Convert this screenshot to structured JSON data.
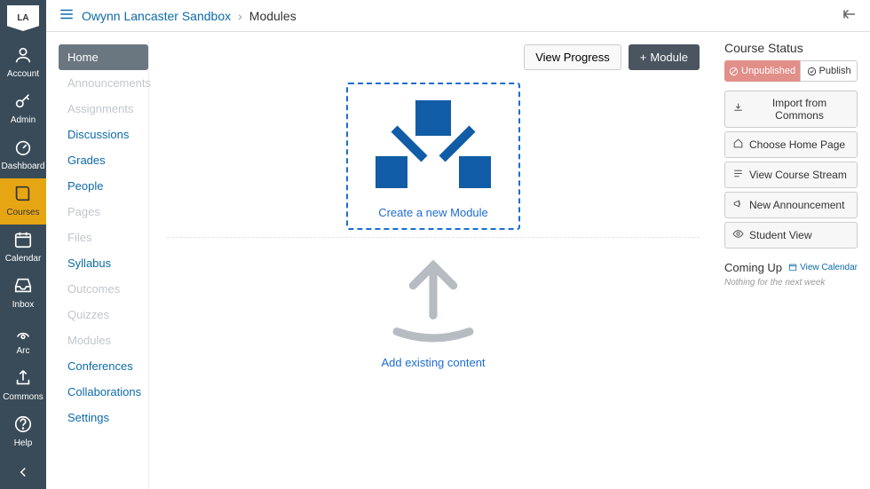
{
  "logo_text": "LA",
  "global_nav": [
    {
      "label": "Account",
      "icon": "user"
    },
    {
      "label": "Admin",
      "icon": "key"
    },
    {
      "label": "Dashboard",
      "icon": "gauge"
    },
    {
      "label": "Courses",
      "icon": "book",
      "active": true
    },
    {
      "label": "Calendar",
      "icon": "calendar"
    },
    {
      "label": "Inbox",
      "icon": "inbox"
    },
    {
      "label": "Arc",
      "icon": "arc"
    },
    {
      "label": "Commons",
      "icon": "share"
    },
    {
      "label": "Help",
      "icon": "help"
    }
  ],
  "breadcrumb": {
    "course": "Owynn Lancaster Sandbox",
    "page": "Modules"
  },
  "course_nav": [
    {
      "label": "Home",
      "active": true
    },
    {
      "label": "Announcements",
      "dim": true
    },
    {
      "label": "Assignments",
      "dim": true
    },
    {
      "label": "Discussions"
    },
    {
      "label": "Grades"
    },
    {
      "label": "People"
    },
    {
      "label": "Pages",
      "dim": true
    },
    {
      "label": "Files",
      "dim": true
    },
    {
      "label": "Syllabus"
    },
    {
      "label": "Outcomes",
      "dim": true
    },
    {
      "label": "Quizzes",
      "dim": true
    },
    {
      "label": "Modules",
      "dim": true
    },
    {
      "label": "Conferences"
    },
    {
      "label": "Collaborations"
    },
    {
      "label": "Settings"
    }
  ],
  "actions": {
    "view_progress": "View Progress",
    "add_module": "Module"
  },
  "dropzone_label": "Create a new Module",
  "upload_label": "Add existing content",
  "sidebar": {
    "status_heading": "Course Status",
    "unpublished": "Unpublished",
    "publish": "Publish",
    "buttons": [
      "Import from Commons",
      "Choose Home Page",
      "View Course Stream",
      "New Announcement",
      "Student View"
    ],
    "coming_up": "Coming Up",
    "view_calendar": "View Calendar",
    "nothing": "Nothing for the next week"
  }
}
